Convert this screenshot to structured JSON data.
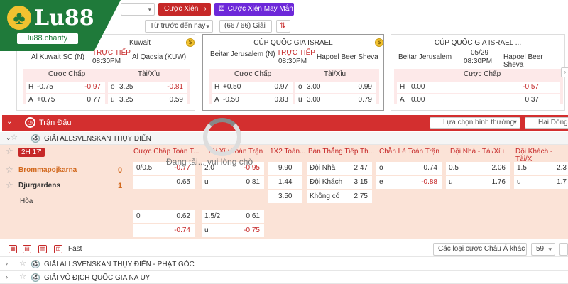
{
  "brand": {
    "name": "Lu88",
    "site": "lu88.charity",
    "colors": {
      "green": "#1f7a3a",
      "gold": "#f2c230",
      "red": "#c62828",
      "purple": "#6d28d9"
    }
  },
  "toolbar": {
    "dropdown1": "",
    "cuoc_xien": "Cược Xiên",
    "cuoc_xien_may_man": "Cược Xiên May Mắn",
    "sort_select": "Từ trước đến nay",
    "league_count": "(66 / 66) Giải"
  },
  "cards": [
    {
      "title": "Kuwait",
      "home": "Al Kuwait SC (N)",
      "live": "TRỰC TIẾP",
      "time": "08:30PM",
      "away": "Al Qadsia (KUW)",
      "hdr_hdp": "Cược Chấp",
      "hdr_ou": "Tài/Xỉu",
      "rows": [
        {
          "side": "H",
          "line": "-0.75",
          "odds": "-0.97",
          "ou_side": "o",
          "ou_line": "3.25",
          "ou_odds": "-0.81"
        },
        {
          "side": "A",
          "line": "+0.75",
          "odds": "0.77",
          "ou_side": "u",
          "ou_line": "3.25",
          "ou_odds": "0.59"
        }
      ]
    },
    {
      "title": "CÚP QUỐC GIA ISRAEL",
      "home": "Beitar Jerusalem (N)",
      "live": "TRỰC TIẾP",
      "time": "08:30PM",
      "away": "Hapoel Beer Sheva",
      "hdr_hdp": "Cược Chấp",
      "hdr_ou": "Tài/Xỉu",
      "rows": [
        {
          "side": "H",
          "line": "+0.50",
          "odds": "0.97",
          "ou_side": "o",
          "ou_line": "3.00",
          "ou_odds": "0.99"
        },
        {
          "side": "A",
          "line": "-0.50",
          "odds": "0.83",
          "ou_side": "u",
          "ou_line": "3.00",
          "ou_odds": "0.79"
        }
      ]
    },
    {
      "title": "CÚP QUỐC GIA ISRAEL ...",
      "home": "Beitar Jerusalem",
      "live": "05/29",
      "time": "08:30PM",
      "away": "Hapoel Beer Sheva",
      "hdr_hdp": "Cược Chấp",
      "rows": [
        {
          "side": "H",
          "line": "0.00",
          "odds": "-0.57"
        },
        {
          "side": "A",
          "line": "0.00",
          "odds": "0.37"
        }
      ]
    }
  ],
  "band": {
    "label": "Trận Đấu",
    "sel1": "Lựa chọn bình thường",
    "sel2": "Hai Dòng"
  },
  "league1": "GIẢI ALLSVENSKAN THỤY ĐIỂN",
  "match": {
    "status": "2H 17'",
    "headers": [
      "Cược Chấp Toàn T...",
      "Tài Xỉu Toàn Trận",
      "1X2 Toàn...",
      "Bàn Thắng Tiếp Th...",
      "Chẵn Lẻ Toàn Trận",
      "Đội Nhà - Tài/Xỉu",
      "Đội Khách - Tài/X"
    ],
    "home": "Brommapojkarna",
    "home_score": "0",
    "away": "Djurgardens",
    "away_score": "1",
    "draw": "Hòa",
    "hdp": [
      {
        "line": "0/0.5",
        "odds": "-0.77"
      },
      {
        "line": "",
        "odds": "0.65"
      }
    ],
    "ou": [
      {
        "line": "2.0",
        "odds": "-0.95"
      },
      {
        "line": "u",
        "odds": "0.81"
      }
    ],
    "x12": [
      "9.90",
      "1.44",
      "3.50"
    ],
    "next_goal": [
      {
        "label": "Đội Nhà",
        "odds": "2.47"
      },
      {
        "label": "Đội Khách",
        "odds": "3.15"
      },
      {
        "label": "Không có",
        "odds": "2.75"
      }
    ],
    "oe": [
      {
        "label": "o",
        "odds": "0.74"
      },
      {
        "label": "e",
        "odds": "-0.88"
      }
    ],
    "home_ou": [
      {
        "line": "0.5",
        "odds": "2.06"
      },
      {
        "line": "u",
        "odds": "1.76"
      }
    ],
    "away_ou": [
      {
        "line": "1.5",
        "odds": "2.3"
      },
      {
        "line": "u",
        "odds": "1.7"
      }
    ],
    "hdp2": [
      {
        "line": "0",
        "odds": "0.62"
      },
      {
        "line": "",
        "odds": "-0.74"
      }
    ],
    "ou2": [
      {
        "line": "1.5/2",
        "odds": "0.61"
      },
      {
        "line": "u",
        "odds": "-0.75"
      }
    ]
  },
  "loading": "Đang tải... vui lòng chờ",
  "tools": {
    "fast": "Fast",
    "odds_type": "Các loại cược Châu Á khác",
    "count": "59"
  },
  "league2": "GIẢI ALLSVENSKAN THỤY ĐIỂN - PHẠT GÓC",
  "league3": "GIẢI VÔ ĐỊCH QUỐC GIA NA UY"
}
